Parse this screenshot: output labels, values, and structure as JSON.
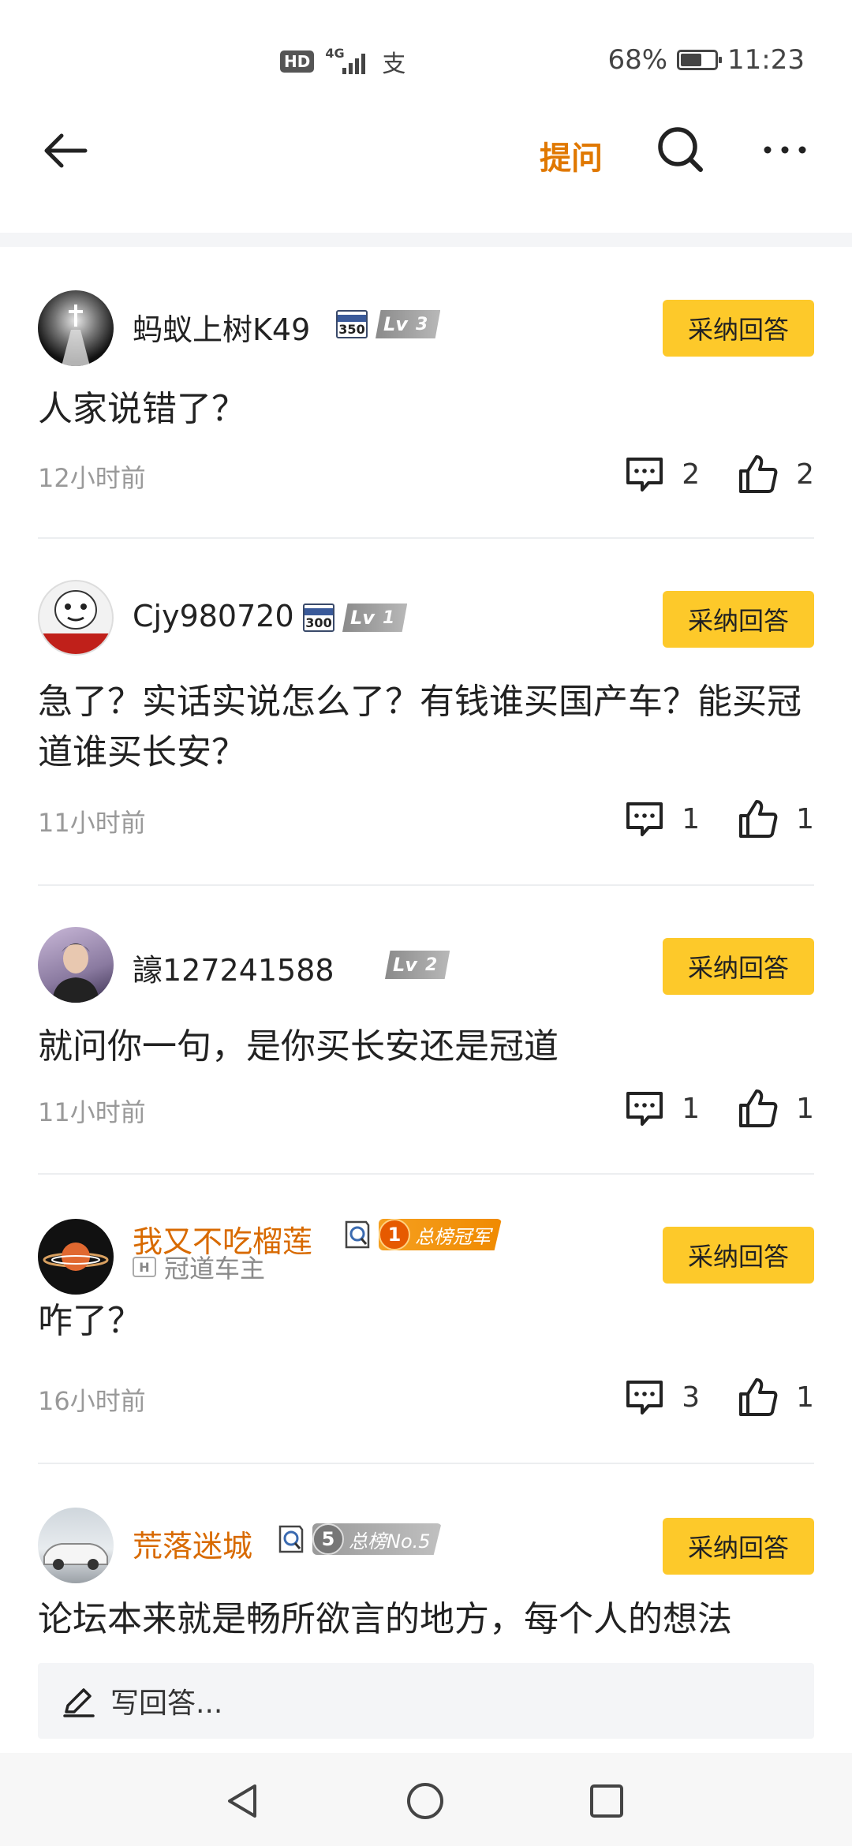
{
  "status_bar": {
    "hd": "HD",
    "network": "4G",
    "alipay_glyph": "支",
    "battery_percent": "68%",
    "battery_level": 0.68,
    "time": "11:23"
  },
  "topnav": {
    "ask_label": "提问",
    "accent_color": "#e07800"
  },
  "answers": [
    {
      "username": "蚂蚁上树K49",
      "vip": false,
      "score_badge": "350",
      "level": "3",
      "adopt_label": "采纳回答",
      "content": "人家说错了？",
      "time": "12小时前",
      "comments": "2",
      "likes": "2"
    },
    {
      "username": "Cjy980720",
      "vip": false,
      "score_badge": "300",
      "level": "1",
      "adopt_label": "采纳回答",
      "content": "急了？实话实说怎么了？有钱谁买国产车？能买冠道谁买长安？",
      "time": "11小时前",
      "comments": "1",
      "likes": "1"
    },
    {
      "username": "譹127241588",
      "vip": false,
      "level": "2",
      "adopt_label": "采纳回答",
      "content": "就问你一句，是你买长安还是冠道",
      "time": "11小时前",
      "comments": "1",
      "likes": "1"
    },
    {
      "username": "我又不吃榴莲",
      "vip": true,
      "rank_number": "1",
      "rank_label": "总榜冠军",
      "car_owner_text": "冠道车主",
      "adopt_label": "采纳回答",
      "content": "咋了？",
      "time": "16小时前",
      "comments": "3",
      "likes": "1"
    },
    {
      "username": "荒落迷城",
      "vip": true,
      "rank_number": "5",
      "rank_label": "总榜No.5",
      "adopt_label": "采纳回答",
      "content": "论坛本来就是畅所欲言的地方，每个人的想法"
    }
  ],
  "compose": {
    "placeholder": "写回答..."
  },
  "colors": {
    "adopt_button": "#fdc92a",
    "vip_name": "#d86a00",
    "rank_gold": "#f08a00"
  }
}
